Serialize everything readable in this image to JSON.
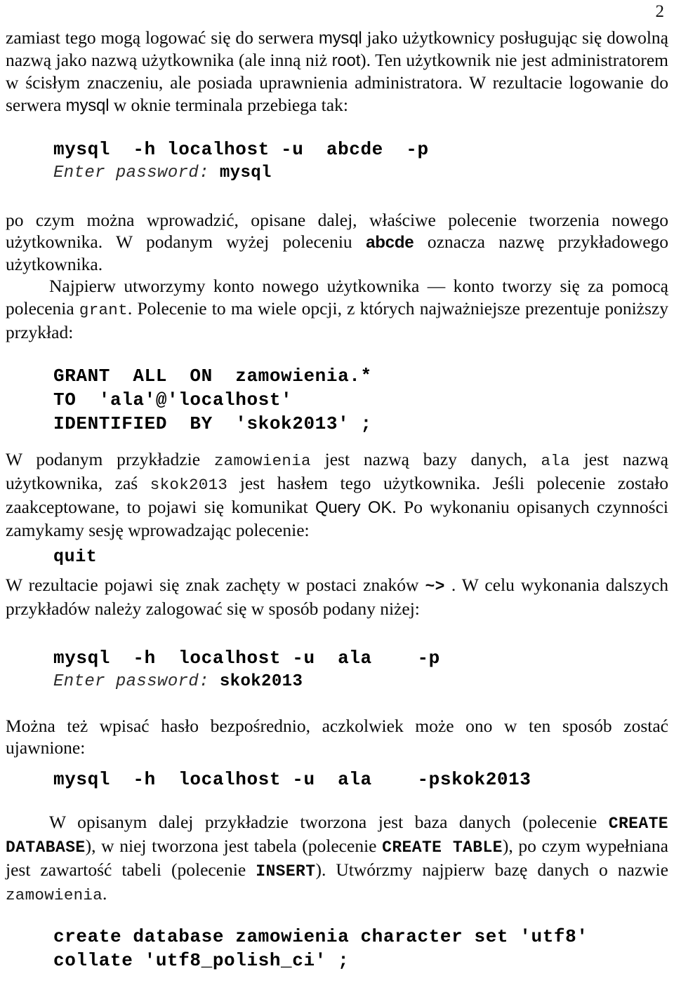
{
  "document": {
    "page_number": "2",
    "language": "pl"
  },
  "paragraphs": {
    "p1": {
      "seg1": "zamiast tego mogą logować się do serwera ",
      "code1": "mysql",
      "seg2": " jako użytkownicy posługując się dowolną nazwą jako nazwą użytkownika (ale inną niż ",
      "code2": "root",
      "seg3": "). Ten użytkownik nie jest administratorem w ścisłym znaczeniu, ale posiada uprawnienia administratora. W rezultacie logowanie do serwera ",
      "code3": "mysql",
      "seg4": " w oknie terminala przebiega tak:"
    },
    "p2": {
      "seg1": "po czym można wprowadzić, opisane dalej, właściwe polecenie tworzenia nowego użytkownika. W podanym wyżej poleceniu ",
      "code1": "abcde",
      "seg2": " oznacza nazwę przykładowego użytkownika."
    },
    "p3": {
      "seg1": "Najpierw utworzymy konto nowego użytkownika — konto tworzy się za pomocą polecenia ",
      "code1": "grant",
      "seg2": ". Polecenie to ma wiele opcji, z których najważniejsze prezentuje poniższy przykład:"
    },
    "p4": {
      "seg1": "W podanym przykładzie ",
      "code1": "zamowienia",
      "seg2": " jest nazwą bazy danych, ",
      "code2": "ala",
      "seg3": " jest nazwą użytkownika, zaś ",
      "code3": "skok2013",
      "seg4": " jest hasłem tego użytkownika. Jeśli polecenie zostało zaakceptowane, to pojawi się komunikat ",
      "code4": "Query OK",
      "seg5": ". Po wykonaniu opisanych czynności zamykamy sesję wprowadzając polecenie:"
    },
    "p5": {
      "seg1": "W rezultacie pojawi się znak zachęty w postaci znaków ",
      "code1": "~>",
      "seg2": " . W celu wykonania dalszych przykładów należy zalogować się w sposób podany niżej:"
    },
    "p6": {
      "seg1": "Można też wpisać hasło bezpośrednio, aczkolwiek może ono w ten sposób zostać ujawnione:"
    },
    "p7": {
      "seg1": "W opisanym dalej przykładzie tworzona jest baza danych (polecenie ",
      "code1": "CREATE  DATABASE",
      "seg2": "), w niej tworzona jest tabela (polecenie ",
      "code2": "CREATE   TABLE",
      "seg3": "), po czym wypełniana jest zawartość tabeli (polecenie ",
      "code3": "INSERT",
      "seg4": "). Utwórzmy najpierw bazę danych o nazwie ",
      "code4": "zamowienia",
      "seg5": "."
    }
  },
  "code_blocks": {
    "login_abcde": {
      "command": "mysql  -h localhost -u  abcde  -p",
      "prompt_label": "Enter password:",
      "prompt_value": "mysql"
    },
    "grant": {
      "line1": "GRANT  ALL  ON  zamowienia.*",
      "line2": "TO  'ala'@'localhost'",
      "line3": "IDENTIFIED  BY  'skok2013' ;"
    },
    "quit": {
      "line1": "quit"
    },
    "login_ala": {
      "command": "mysql  -h  localhost -u  ala    -p",
      "prompt_label": "Enter password:",
      "prompt_value": "skok2013"
    },
    "login_ala_inline": {
      "command": "mysql  -h  localhost -u  ala    -pskok2013"
    },
    "create_database": {
      "line1": "create database zamowienia character set 'utf8'",
      "line2": "collate 'utf8_polish_ci' ;"
    }
  }
}
